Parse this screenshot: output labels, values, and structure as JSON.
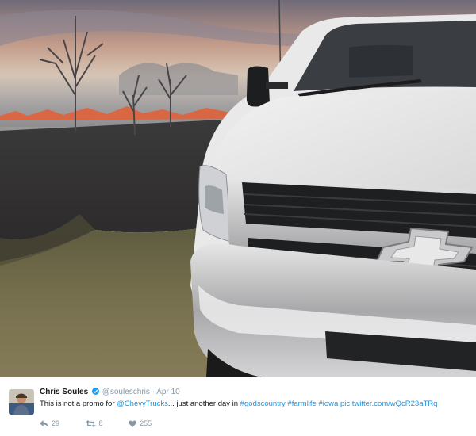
{
  "photo": {
    "description_icon": "photo-image"
  },
  "tweet": {
    "display_name": "Chris Soules",
    "handle": "@souleschris",
    "separator": "·",
    "date": "Apr 10",
    "text_prefix": "This is not a promo for ",
    "mention": "@ChevyTrucks",
    "text_mid": "... just another day in ",
    "hashtag_1": "#godscountry",
    "hashtag_2": "#farmlife",
    "hashtag_3": "#iowa",
    "link": "pic.twitter.com/wQcR23aTRq",
    "reply_count": "29",
    "retweet_count": "8",
    "like_count": "255"
  },
  "colors": {
    "link": "#1b95e0",
    "muted": "#8899a6",
    "text": "#14171a",
    "verified": "#1da1f2"
  },
  "icons": {
    "verified": "verified-badge-icon",
    "reply": "reply-icon",
    "retweet": "retweet-icon",
    "like": "heart-icon"
  }
}
